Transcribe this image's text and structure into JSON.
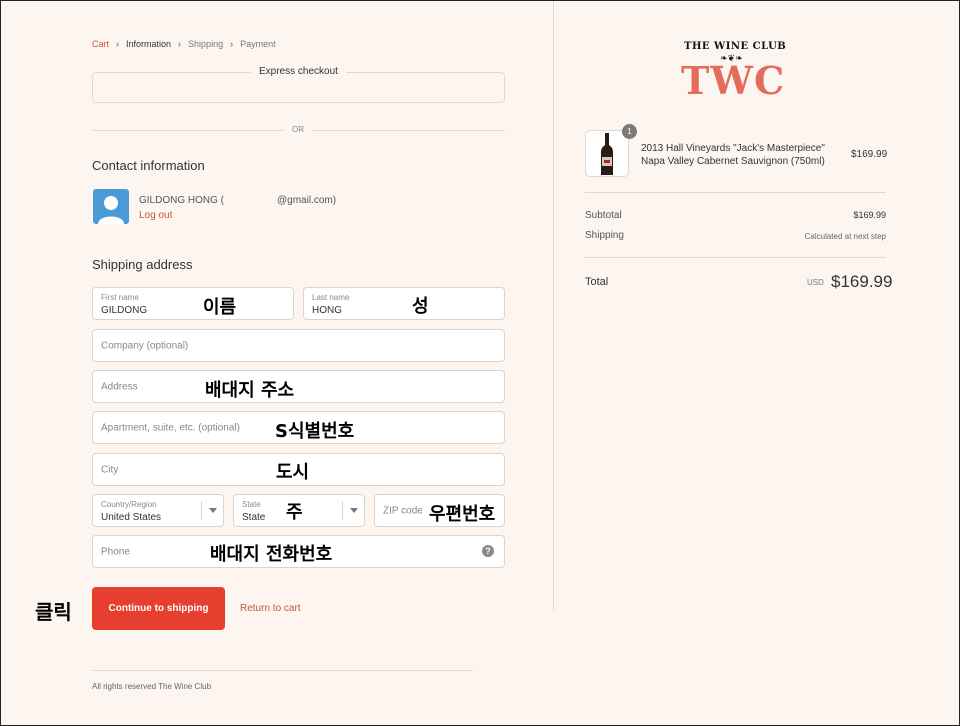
{
  "breadcrumb": {
    "items": [
      "Cart",
      "Information",
      "Shipping",
      "Payment"
    ]
  },
  "express": {
    "label": "Express checkout",
    "or_label": "OR"
  },
  "contact": {
    "heading": "Contact information",
    "user_name": "GILDONG HONG (",
    "user_email": "@gmail.com)",
    "logout": "Log out"
  },
  "shipping": {
    "heading": "Shipping address",
    "first_name": {
      "label": "First name",
      "value": "GILDONG",
      "annotation": "이름"
    },
    "last_name": {
      "label": "Last name",
      "value": "HONG",
      "annotation": "성"
    },
    "company": {
      "placeholder": "Company (optional)"
    },
    "address": {
      "placeholder": "Address",
      "annotation": "배대지 주소"
    },
    "apartment": {
      "placeholder": "Apartment, suite, etc. (optional)",
      "annotation": "S식별번호"
    },
    "city": {
      "placeholder": "City",
      "annotation": "도시"
    },
    "country": {
      "label": "Country/Region",
      "value": "United States"
    },
    "state": {
      "label": "State",
      "value": "State",
      "annotation": "주"
    },
    "zip": {
      "placeholder": "ZIP code",
      "annotation": "우편번호"
    },
    "phone": {
      "placeholder": "Phone",
      "annotation": "배대지 전화번호",
      "help": "?"
    }
  },
  "actions": {
    "continue_label": "Continue to shipping",
    "return_label": "Return to cart",
    "click_annotation": "클릭"
  },
  "footer": {
    "text": "All rights reserved The Wine Club"
  },
  "brand": {
    "top_text": "THE WINE CLUB",
    "ornament": "❧❦❧",
    "main_text": "TWC",
    "color": "#e56b5a"
  },
  "order": {
    "product": {
      "quantity": "1",
      "name": "2013 Hall Vineyards \"Jack's Masterpiece\" Napa Valley Cabernet Sauvignon (750ml)",
      "price": "$169.99"
    },
    "subtotal_label": "Subtotal",
    "subtotal_value": "$169.99",
    "shipping_label": "Shipping",
    "shipping_value": "Calculated at next step",
    "total_label": "Total",
    "currency": "USD",
    "total_value": "$169.99"
  },
  "colors": {
    "accent": "#e63e2f",
    "link": "#c8553d",
    "background": "#fdf5f0"
  }
}
